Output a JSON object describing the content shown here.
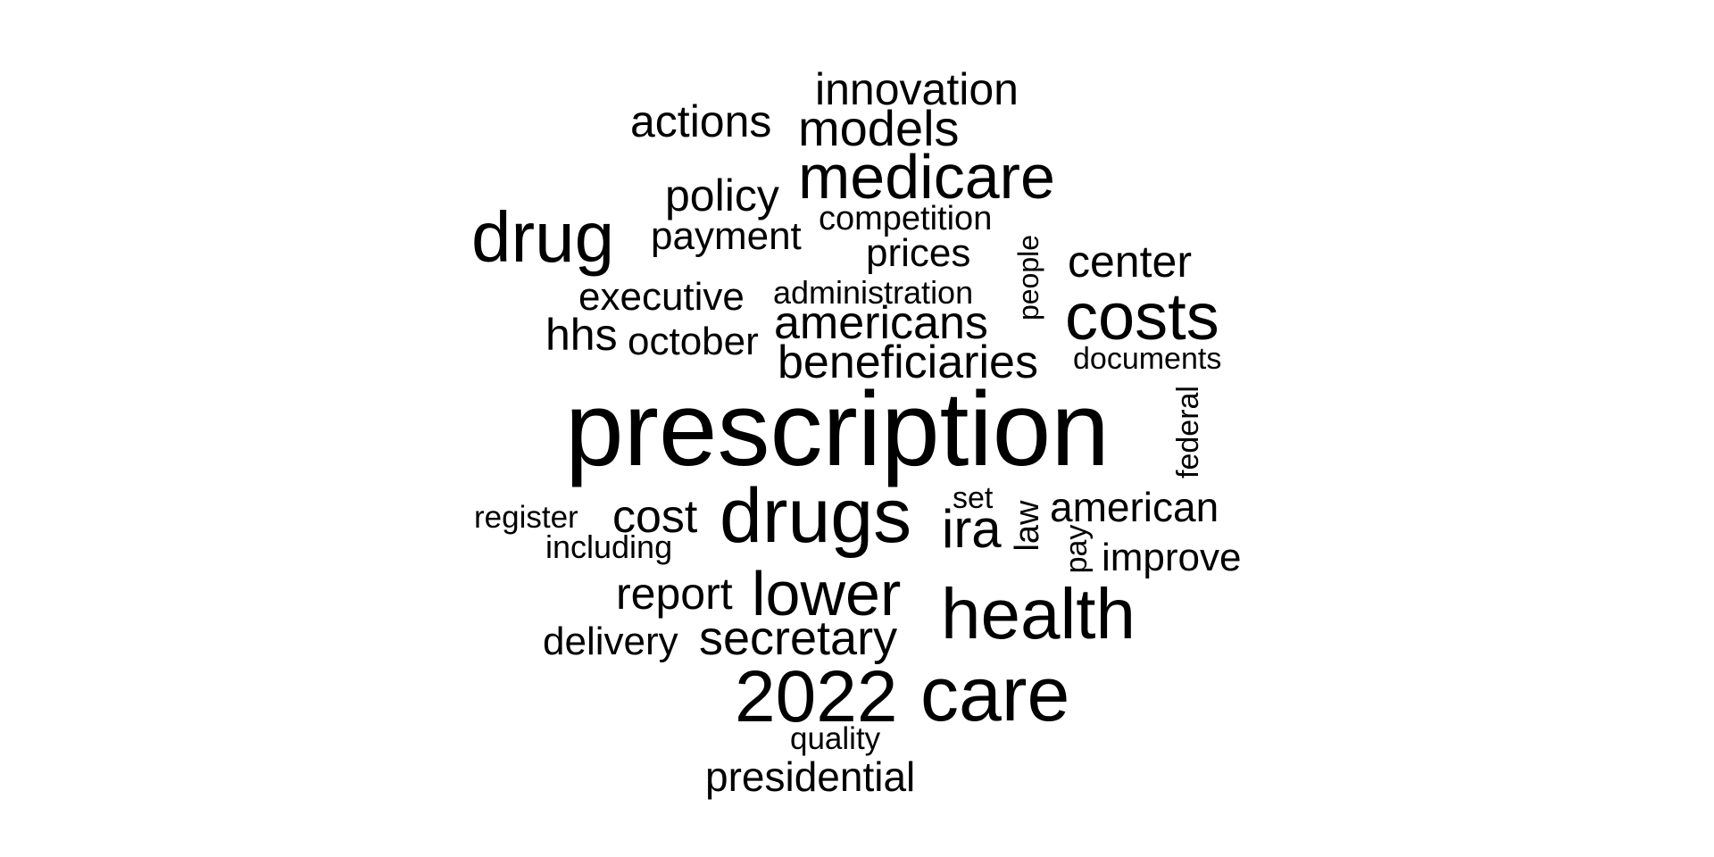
{
  "word_cloud": {
    "text_color": "#000000",
    "background_color": "#ffffff",
    "words": [
      {
        "text": "prescription"
      },
      {
        "text": "drugs"
      },
      {
        "text": "care"
      },
      {
        "text": "health"
      },
      {
        "text": "2022"
      },
      {
        "text": "drug"
      },
      {
        "text": "costs"
      },
      {
        "text": "medicare"
      },
      {
        "text": "lower"
      },
      {
        "text": "secretary"
      },
      {
        "text": "americans"
      },
      {
        "text": "beneficiaries"
      },
      {
        "text": "models"
      },
      {
        "text": "innovation"
      },
      {
        "text": "actions"
      },
      {
        "text": "policy"
      },
      {
        "text": "payment"
      },
      {
        "text": "competition"
      },
      {
        "text": "prices"
      },
      {
        "text": "center"
      },
      {
        "text": "executive"
      },
      {
        "text": "administration"
      },
      {
        "text": "people"
      },
      {
        "text": "hhs"
      },
      {
        "text": "october"
      },
      {
        "text": "documents"
      },
      {
        "text": "federal"
      },
      {
        "text": "register"
      },
      {
        "text": "cost"
      },
      {
        "text": "set"
      },
      {
        "text": "ira"
      },
      {
        "text": "law"
      },
      {
        "text": "american"
      },
      {
        "text": "including"
      },
      {
        "text": "pay"
      },
      {
        "text": "improve"
      },
      {
        "text": "report"
      },
      {
        "text": "delivery"
      },
      {
        "text": "quality"
      },
      {
        "text": "presidential"
      }
    ]
  }
}
